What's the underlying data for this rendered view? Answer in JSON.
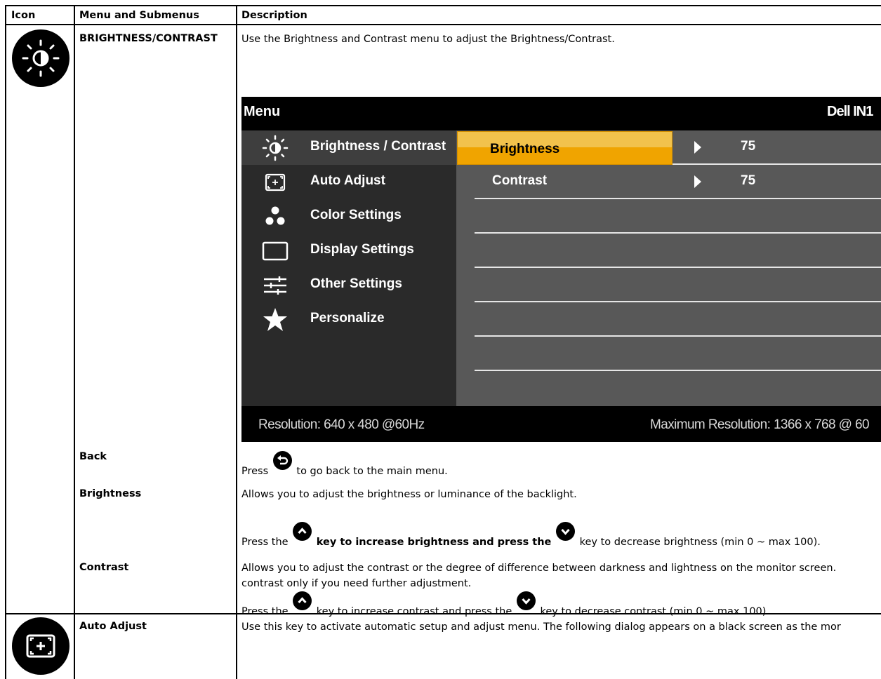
{
  "table": {
    "headers": {
      "icon": "Icon",
      "menu": "Menu and Submenus",
      "description": "Description"
    }
  },
  "rows": {
    "brightness_contrast": {
      "menu": "BRIGHTNESS/CONTRAST",
      "description": "Use the Brightness and Contrast menu to adjust the Brightness/Contrast.",
      "icon": "brightness-sun-icon"
    },
    "back": {
      "menu": "Back",
      "desc_before": "Press",
      "desc_after": "to go back to the main menu.",
      "icon": "back-button-icon"
    },
    "brightness": {
      "menu": "Brightness",
      "description": "Allows you to adjust the brightness or luminance of the backlight.",
      "press_1": "Press the",
      "press_2": "key to increase brightness and press the",
      "press_3": "key to decrease brightness (min 0 ~ max 100)."
    },
    "contrast": {
      "menu": "Contrast",
      "description_line1": "Allows you to adjust the contrast or the degree of difference between darkness and lightness on the monitor screen.",
      "description_line2": "contrast only if you need further adjustment.",
      "press_1": "Press the",
      "press_2": "key to increase contrast and press the",
      "press_3": "key to decrease contrast (min 0 ~ max 100)."
    },
    "auto_adjust": {
      "menu": "Auto Adjust",
      "description": "Use this key to activate automatic setup and adjust menu. The following dialog appears on a black screen as the mor",
      "icon": "auto-adjust-icon"
    }
  },
  "osd": {
    "title": "Menu",
    "brand": "Dell IN1",
    "menu_items": [
      {
        "label": "Brightness / Contrast",
        "icon": "sun-icon",
        "active": true
      },
      {
        "label": "Auto Adjust",
        "icon": "auto-adjust-icon"
      },
      {
        "label": "Color Settings",
        "icon": "color-dots-icon"
      },
      {
        "label": "Display Settings",
        "icon": "display-rectangle-icon"
      },
      {
        "label": "Other Settings",
        "icon": "sliders-icon"
      },
      {
        "label": "Personalize",
        "icon": "star-icon"
      }
    ],
    "submenu": [
      {
        "label": "Brightness",
        "value": "75",
        "selected": true
      },
      {
        "label": "Contrast",
        "value": "75"
      }
    ],
    "footer_left": "Resolution: 640 x 480 @60Hz",
    "footer_right": "Maximum Resolution: 1366 x 768 @ 60",
    "colors": {
      "highlight": "#f0a400",
      "panel_left": "#2a2a2a",
      "panel_right": "#585858"
    }
  }
}
